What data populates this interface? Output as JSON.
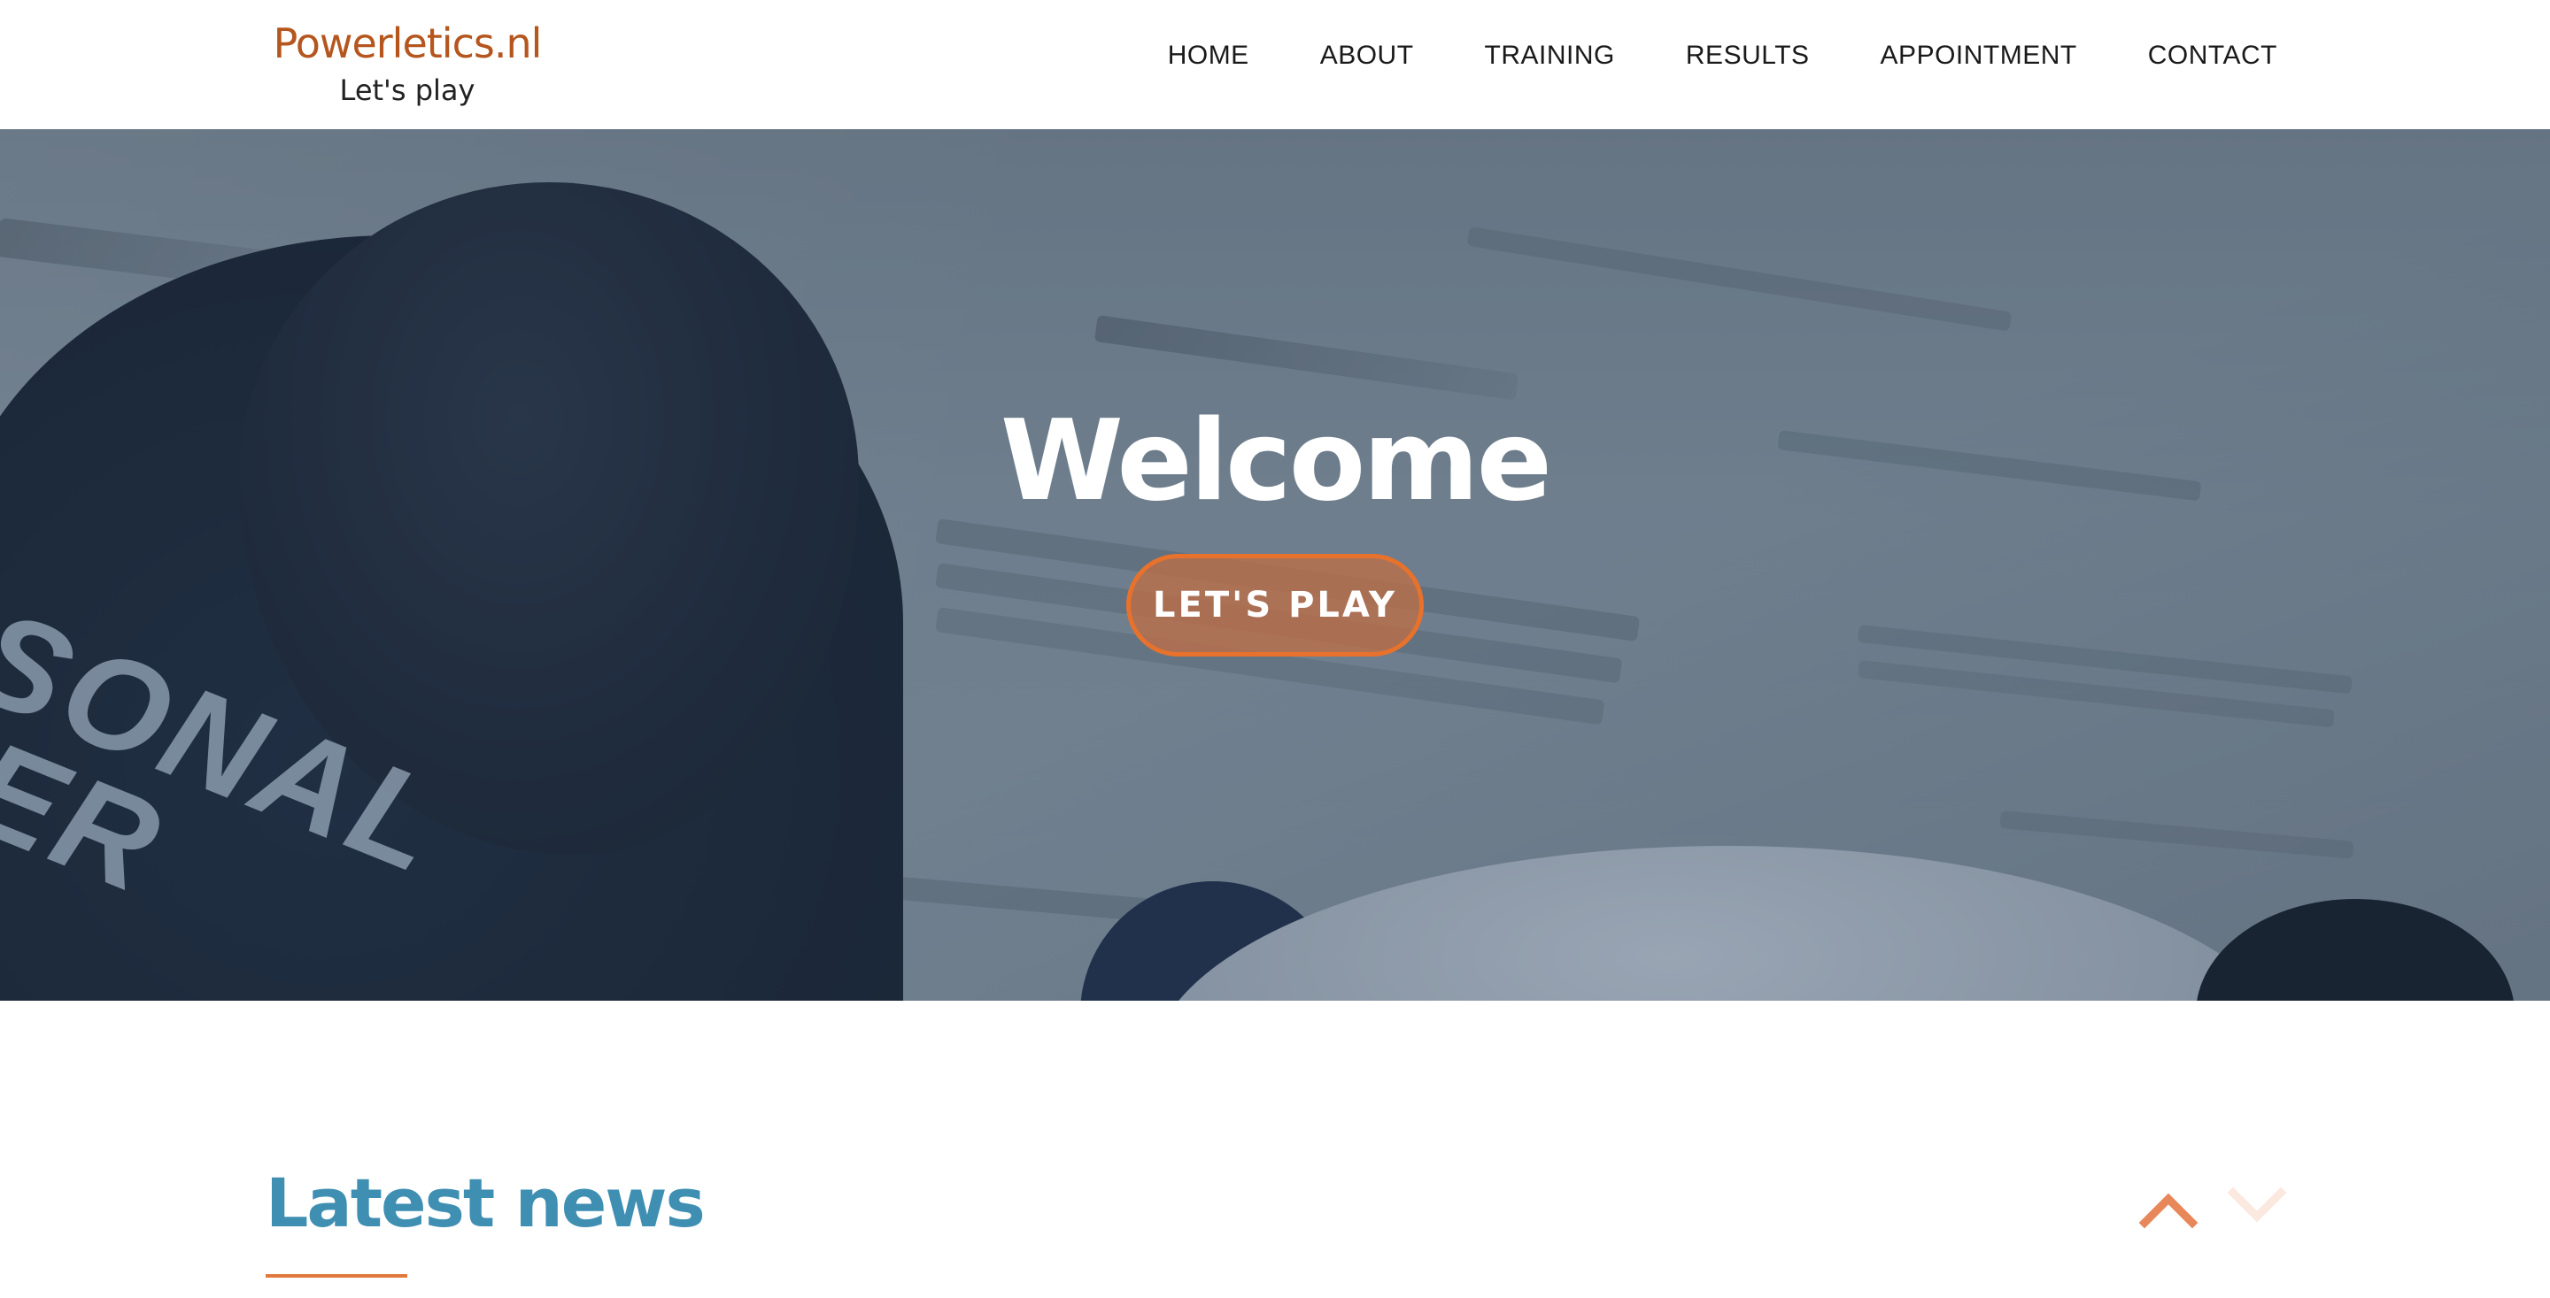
{
  "header": {
    "brand_name": "Powerletics.nl",
    "brand_tagline": "Let's play",
    "nav": [
      {
        "label": "HOME"
      },
      {
        "label": "ABOUT"
      },
      {
        "label": "TRAINING"
      },
      {
        "label": "RESULTS"
      },
      {
        "label": "APPOINTMENT"
      },
      {
        "label": "CONTACT"
      }
    ]
  },
  "hero": {
    "title": "Welcome",
    "cta_label": "LET'S PLAY",
    "shirt_text": "RSONAL\nNER"
  },
  "news": {
    "title": "Latest news",
    "prev_icon": "chevron-up-icon",
    "next_icon": "chevron-down-icon"
  },
  "colors": {
    "brand": "#b5561e",
    "accent": "#e8722c",
    "news_title": "#3f8fb3",
    "arrow_active": "#e8875a",
    "arrow_inactive": "#fbe8df"
  }
}
